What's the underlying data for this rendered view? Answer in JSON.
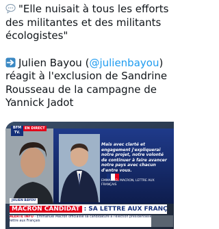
{
  "post": {
    "quote_text": "\"Elle nuisait à tous les efforts des militantes et des militants écologistes\"",
    "body_prefix": "Julien Bayou (",
    "mention": "@julienbayou",
    "body_suffix": ") réagit à l'exclusion de Sandrine Rousseau de la campagne de Yannick Jadot"
  },
  "video": {
    "logo_text": "BFM TV.",
    "live_tag": "EN DIRECT",
    "quote": "Mais avec clarté et engagement j'expliquerai notre projet, notre volonté de continuer à faire avancer notre pays avec chacun d'entre vous.",
    "quote_source": "EMMANUEL MACRON, LETTRE AUX FRANÇAIS",
    "speaker": "JULIEN BAYOU",
    "headline_a": "MACRON CANDIDAT",
    "headline_b": ": SA LETTRE AUX FRANÇAIS",
    "ticker_alert": "ALERTE INFO",
    "ticker_text": " - Emmanuel Macron officialise sa candidature à l'élection présidentielle dans une lettre aux Français"
  },
  "colors": {
    "mention": "#1d9bf0",
    "text": "#0f1419",
    "brand_blue": "#142f78",
    "alert_red": "#e2001a"
  },
  "icons": {
    "speech": "speech-balloon-emoji",
    "arrow": "right-arrow-emoji"
  }
}
